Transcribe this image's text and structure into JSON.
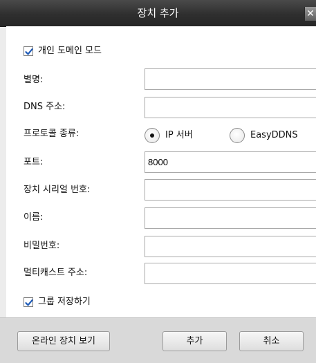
{
  "dialog": {
    "title": "장치 추가",
    "close_symbol": "✕",
    "private_domain_mode": {
      "label": "개인 도메인 모드",
      "checked": true
    },
    "fields": {
      "alias": {
        "label": "별명:",
        "value": ""
      },
      "dns_address": {
        "label": "DNS 주소:",
        "value": ""
      },
      "port": {
        "label": "포트:",
        "value": "8000"
      },
      "serial_number": {
        "label": "장치 시리얼 번호:",
        "value": ""
      },
      "username": {
        "label": "이름:",
        "value": ""
      },
      "password": {
        "label": "비밀번호:",
        "value": ""
      },
      "multicast_address": {
        "label": "멀티캐스트 주소:",
        "value": ""
      }
    },
    "protocol": {
      "label": "프로토콜 종류:",
      "options": [
        {
          "label": "IP 서버",
          "selected": true
        },
        {
          "label": "EasyDDNS",
          "selected": false
        }
      ]
    },
    "save_to_group": {
      "label": "그룹 저장하기",
      "checked": true
    },
    "buttons": {
      "online_devices": "온라인 장치 보기",
      "add": "추가",
      "cancel": "취소"
    }
  }
}
